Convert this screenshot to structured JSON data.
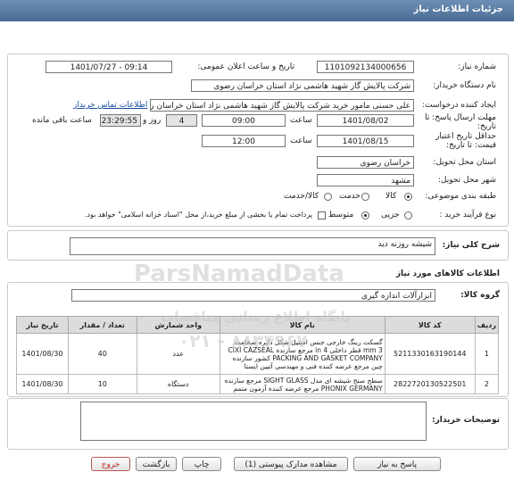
{
  "header": {
    "title": "جزئیات اطلاعات نیاز"
  },
  "form": {
    "need_number_label": "شماره نیاز:",
    "need_number": "1101092134000656",
    "announce_label": "تاریخ و ساعت اعلان عمومی:",
    "announce_value": "1401/07/27 - 09:14",
    "buyer_org_label": "نام دستگاه خریدار:",
    "buyer_org": "شرکت پالایش گاز شهید هاشمی نژاد   استان خراسان رضوی",
    "requester_label": "ایجاد کننده درخواست:",
    "requester": "علی حسنی مامور خرید شرکت پالایش گاز شهید هاشمی نژاد   استان خراسان رضوی",
    "contact_link": "اطلاعات تماس خریدار",
    "send_deadline_label": "مهلت ارسال پاسخ: تا تاریخ:",
    "send_date": "1401/08/02",
    "time_label": "ساعت",
    "send_time": "09:00",
    "days_value": "4",
    "days_label": "روز و",
    "remaining_time": "23:29:55",
    "remaining_label": "ساعت باقی مانده",
    "price_validity_label": "حداقل تاریخ اعتبار قیمت: تا تاریخ:",
    "price_date": "1401/08/15",
    "price_time": "12:00",
    "province_label": "استان محل تحویل:",
    "province": "خراسان رضوی",
    "city_label": "شهر محل تحویل:",
    "city": "مشهد",
    "category_label": "طبقه بندی موضوعی:",
    "category_options": [
      "کالا",
      "خدمت",
      "کالا/خدمت"
    ],
    "process_label": "نوع فرآیند خرید :",
    "process_options": [
      "جزیی",
      "متوسط"
    ],
    "payment_note": "پرداخت تمام یا بخشی از مبلغ خرید،از محل \"اسناد خزانه اسلامی\" خواهد بود."
  },
  "general": {
    "desc_label": "شرح کلی نیاز:",
    "desc_value": "شیشه روزنه دید"
  },
  "goods": {
    "section_title": "اطلاعات کالاهای مورد نیاز",
    "group_label": "گروه کالا:",
    "group_value": "ابزارآلات اندازه گیری",
    "columns": [
      "ردیف",
      "کد کالا",
      "نام کالا",
      "واحد شمارش",
      "تعداد / مقدار",
      "تاریخ نیاز"
    ],
    "rows": [
      {
        "row": "1",
        "code": "5211330163190144",
        "name": "گسکت رینگ خارجی جنس استیل شکل دایره ضخامت mm 3 قطر داخلی in 4 مرجع سازنده CIXI CAZSEAL PACKING AND GASKET COMPANY کشور سازنده چین مرجع عرضه کننده فنی و مهندسی آتیین ایستا",
        "unit": "عدد",
        "qty": "40",
        "date": "1401/08/30"
      },
      {
        "row": "2",
        "code": "2822720130522501",
        "name": "سطح سنج شیشه ای مدل SIGHT GLASS مرجع سازنده PHONIX GERMANY مرجع عرضه کننده آزمون متمم",
        "unit": "دستگاه",
        "qty": "10",
        "date": "1401/08/30"
      }
    ]
  },
  "buyer_notes": {
    "label": "توضیحات خریدار:",
    "value": ""
  },
  "buttons": {
    "reply": "پاسخ به نیاز",
    "view_docs": "مشاهده مدارک پیوستی (1)",
    "print": "چاپ",
    "back": "بازگشت",
    "exit": "خروج"
  },
  "watermark": {
    "brand": "ParsNamadData",
    "line1": "پایگاه اطلاع رسانی مناقصات",
    "line2": "۰۲۱ - ۸۸۳۴۹۶۷"
  },
  "colors": {
    "header": "#5a7ca3",
    "link": "#1a4fa0",
    "exit": "#b22222"
  }
}
